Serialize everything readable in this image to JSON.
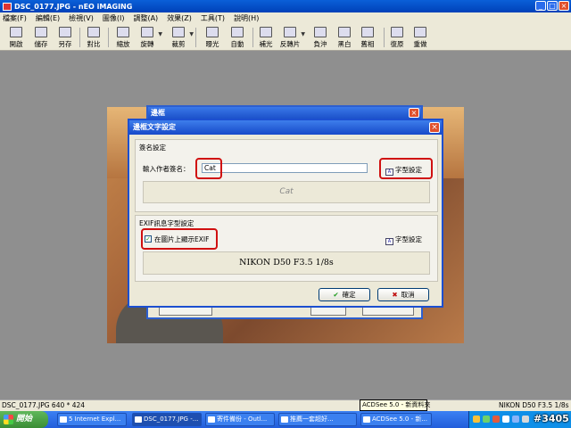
{
  "window": {
    "title": "DSC_0177.JPG - nEO iMAGING"
  },
  "menu": [
    "檔案(F)",
    "編輯(E)",
    "檢視(V)",
    "圖像(I)",
    "調整(A)",
    "效果(Z)",
    "工具(T)",
    "說明(H)"
  ],
  "toolbar": [
    "開啟",
    "儲存",
    "另存",
    "對比",
    "縮放",
    "旋轉",
    "裁剪",
    "曝光",
    "自動",
    "補光",
    "反轉片",
    "負沖",
    "黑白",
    "舊相",
    "復原",
    "重做"
  ],
  "back_dialog": {
    "title": "邊框"
  },
  "dialog": {
    "title": "邊框文字設定",
    "signature_group": "簽名設定",
    "author_label": "輸入作者簽名：",
    "author_value": "Cat",
    "font_button": "字型設定",
    "signature_preview": "Cat",
    "exif_group": "EXIF訊息字型設定",
    "exif_checkbox": "在圖片上顯示EXIF",
    "exif_checked": true,
    "exif_font_button": "字型設定",
    "exif_preview": "NIKON D50 F3.5 1/8s",
    "ok": "確定",
    "cancel": "取消"
  },
  "status": {
    "file": "DSC_0177.JPG  640 * 424",
    "tooltip": "ACDSee 5.0 - 新資料夾",
    "exif": "NIKON D50 F3.5 1/8s"
  },
  "taskbar": {
    "start": "開始",
    "tasks": [
      "5 Internet Expl...",
      "DSC_0177.JPG -...",
      "寄件備份 - Outl...",
      "推薦一套超好...",
      "ACDSee 5.0 - 新..."
    ]
  },
  "watermark": "#3405",
  "colors": {
    "titlebar": "#0a5fd8",
    "highlight": "#d01010",
    "dialog_bg": "#ece9d8"
  }
}
